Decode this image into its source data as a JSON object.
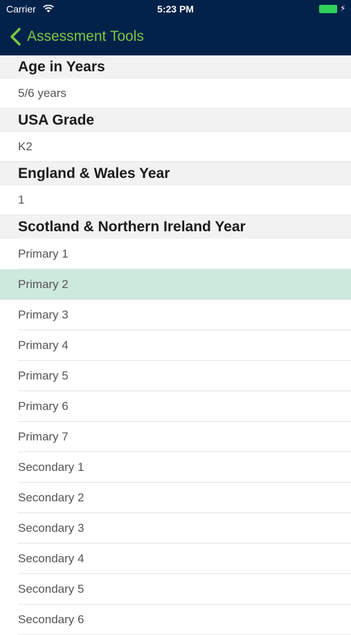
{
  "status_bar": {
    "carrier": "Carrier",
    "time": "5:23 PM"
  },
  "nav": {
    "back_label": "Assessment Tools"
  },
  "sections": [
    {
      "header": "Age in Years",
      "value": "5/6 years"
    },
    {
      "header": "USA Grade",
      "value": "K2"
    },
    {
      "header": "England & Wales Year",
      "value": "1"
    }
  ],
  "scotland": {
    "header": "Scotland & Northern Ireland Year",
    "selected_index": 1,
    "items": [
      "Primary 1",
      "Primary 2",
      "Primary 3",
      "Primary 4",
      "Primary 5",
      "Primary 6",
      "Primary 7",
      "Secondary 1",
      "Secondary 2",
      "Secondary 3",
      "Secondary 4",
      "Secondary 5",
      "Secondary 6"
    ]
  },
  "colors": {
    "nav_background": "#03224a",
    "accent": "#7ac943",
    "selection": "#cde8dd",
    "header_background": "#f2f2f3"
  }
}
